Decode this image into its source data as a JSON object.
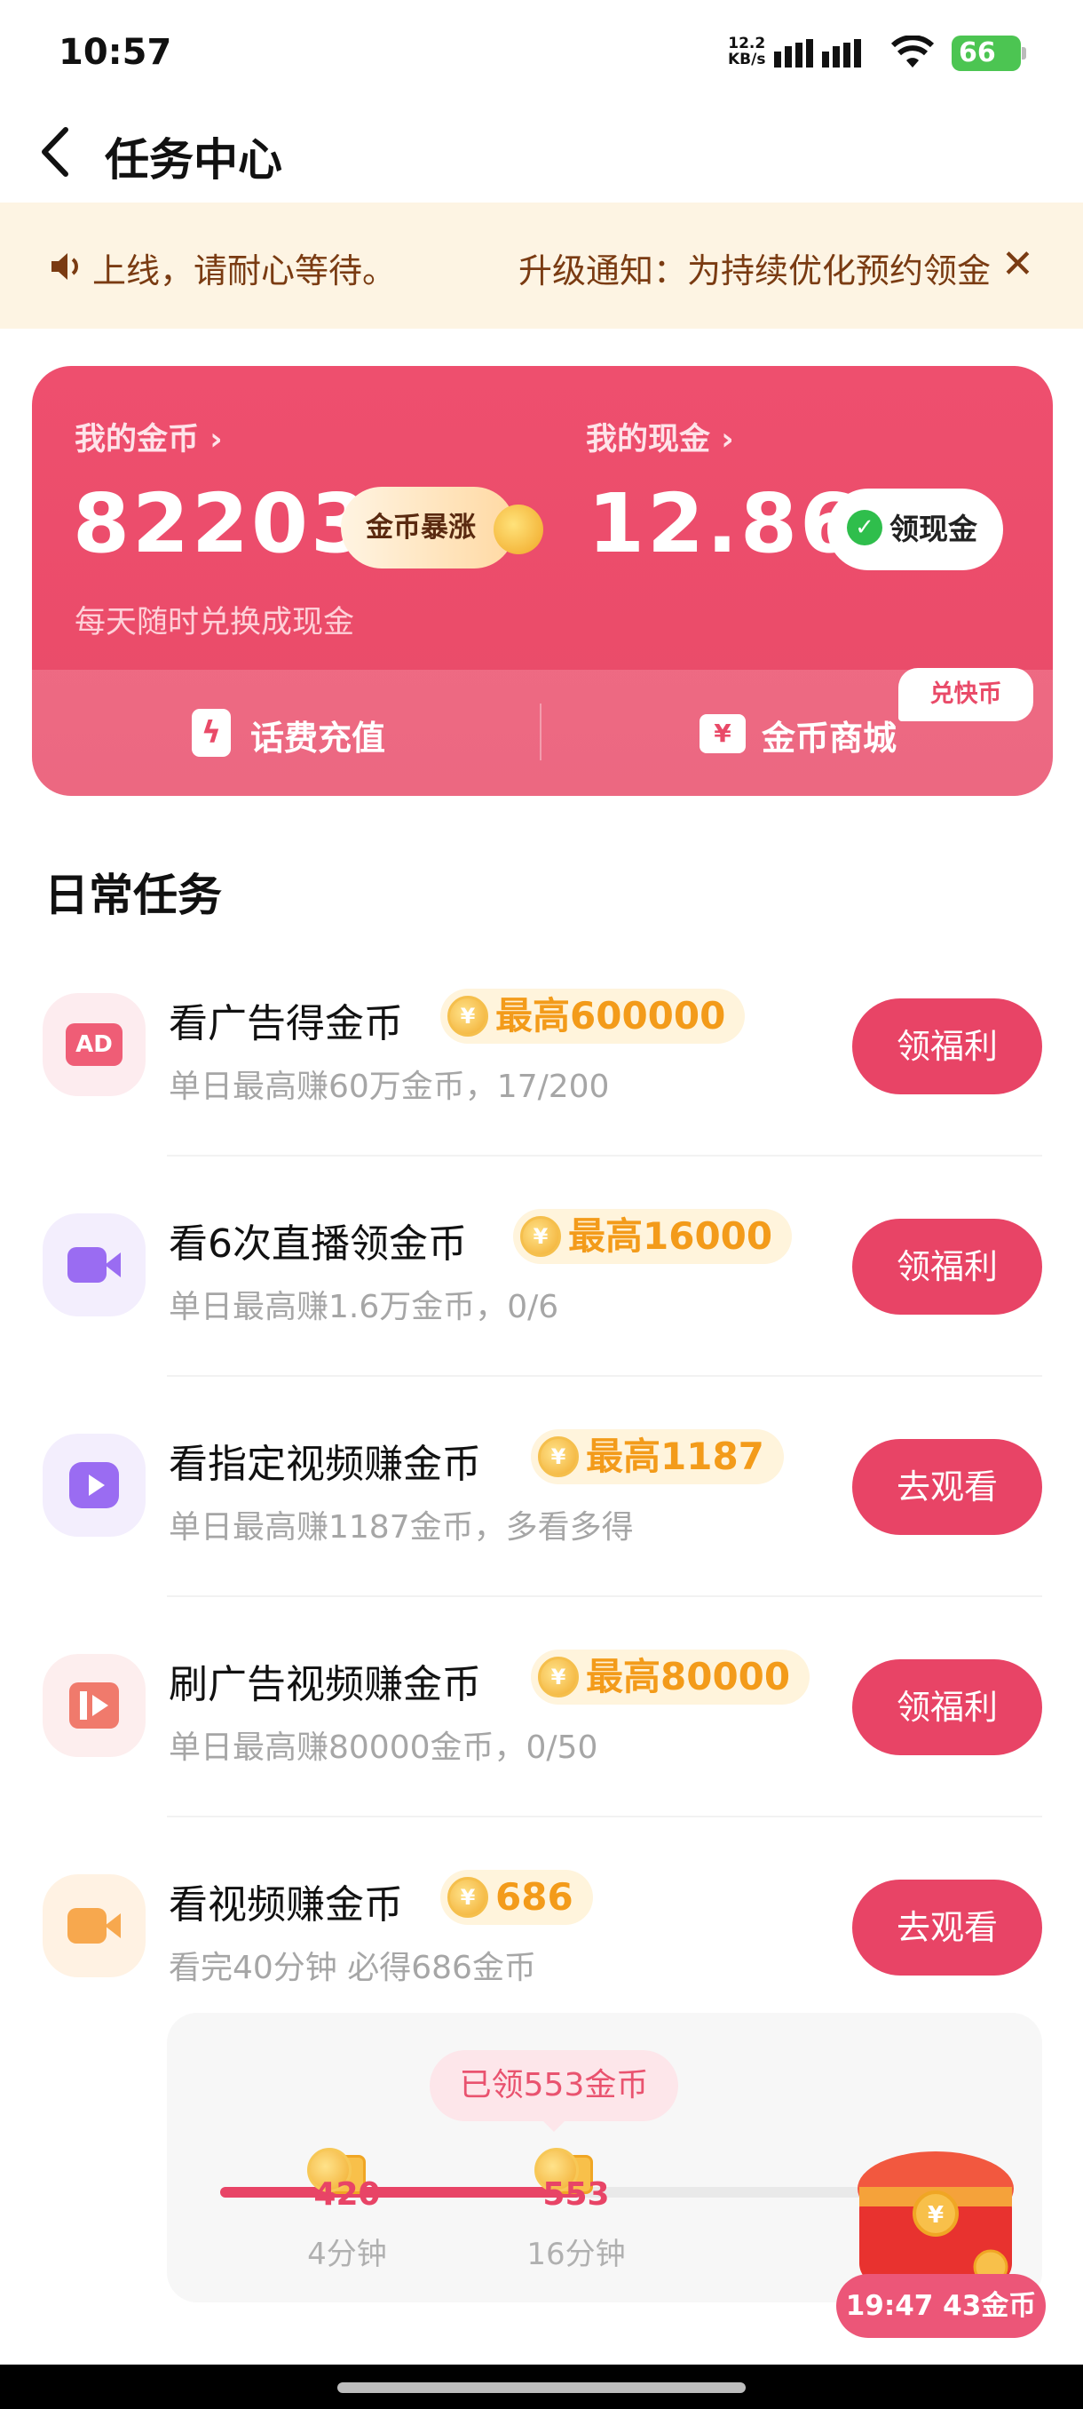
{
  "status_bar": {
    "time": "10:57",
    "net_speed_value": "12.2",
    "net_speed_unit": "KB/s",
    "battery": "66"
  },
  "header": {
    "title": "任务中心",
    "back_icon": "chevron-left-icon"
  },
  "notice": {
    "text_left": "上线，请耐心等待。",
    "text_right": "升级通知：为持续优化预约领金",
    "icon": "speaker-icon",
    "close_icon": "close-icon"
  },
  "wallet": {
    "coins_label": "我的金币",
    "coins_value": "82203",
    "boom_label": "金币暴涨",
    "cash_label": "我的现金",
    "cash_value": "12.86",
    "cash_button": "领现金",
    "subtitle": "每天随时兑换成现金",
    "topup_label": "话费充值",
    "mall_label": "金币商城",
    "mall_badge": "兑快币",
    "accent": "#e94a68"
  },
  "daily": {
    "title": "日常任务",
    "tasks": [
      {
        "title": "看广告得金币",
        "reward": "最高600000",
        "sub": "单日最高赚60万金币，17/200",
        "button": "领福利",
        "icon": "ad-icon",
        "icon_bg": "#fdecef"
      },
      {
        "title": "看6次直播领金币",
        "reward": "最高16000",
        "sub": "单日最高赚1.6万金币，0/6",
        "button": "领福利",
        "icon": "live-camera-icon",
        "icon_bg": "#f3eefd"
      },
      {
        "title": "看指定视频赚金币",
        "reward": "最高1187",
        "sub": "单日最高赚1187金币，多看多得",
        "button": "去观看",
        "icon": "play-icon",
        "icon_bg": "#f3eefd"
      },
      {
        "title": "刷广告视频赚金币",
        "reward": "最高80000",
        "sub": "单日最高赚80000金币，0/50",
        "button": "领福利",
        "icon": "video-ad-icon",
        "icon_bg": "#fdeeee"
      },
      {
        "title": "看视频赚金币",
        "reward": "686",
        "sub": "看完40分钟 必得686金币",
        "button": "去观看",
        "icon": "video-camera-icon",
        "icon_bg": "#fff2e3"
      }
    ]
  },
  "progress": {
    "bubble": "已领553金币",
    "milestones": [
      {
        "coins": "420",
        "time": "4分钟"
      },
      {
        "coins": "553",
        "time": "16分钟"
      }
    ],
    "fill_fraction": 0.49,
    "timer": "19:47 43金币"
  }
}
